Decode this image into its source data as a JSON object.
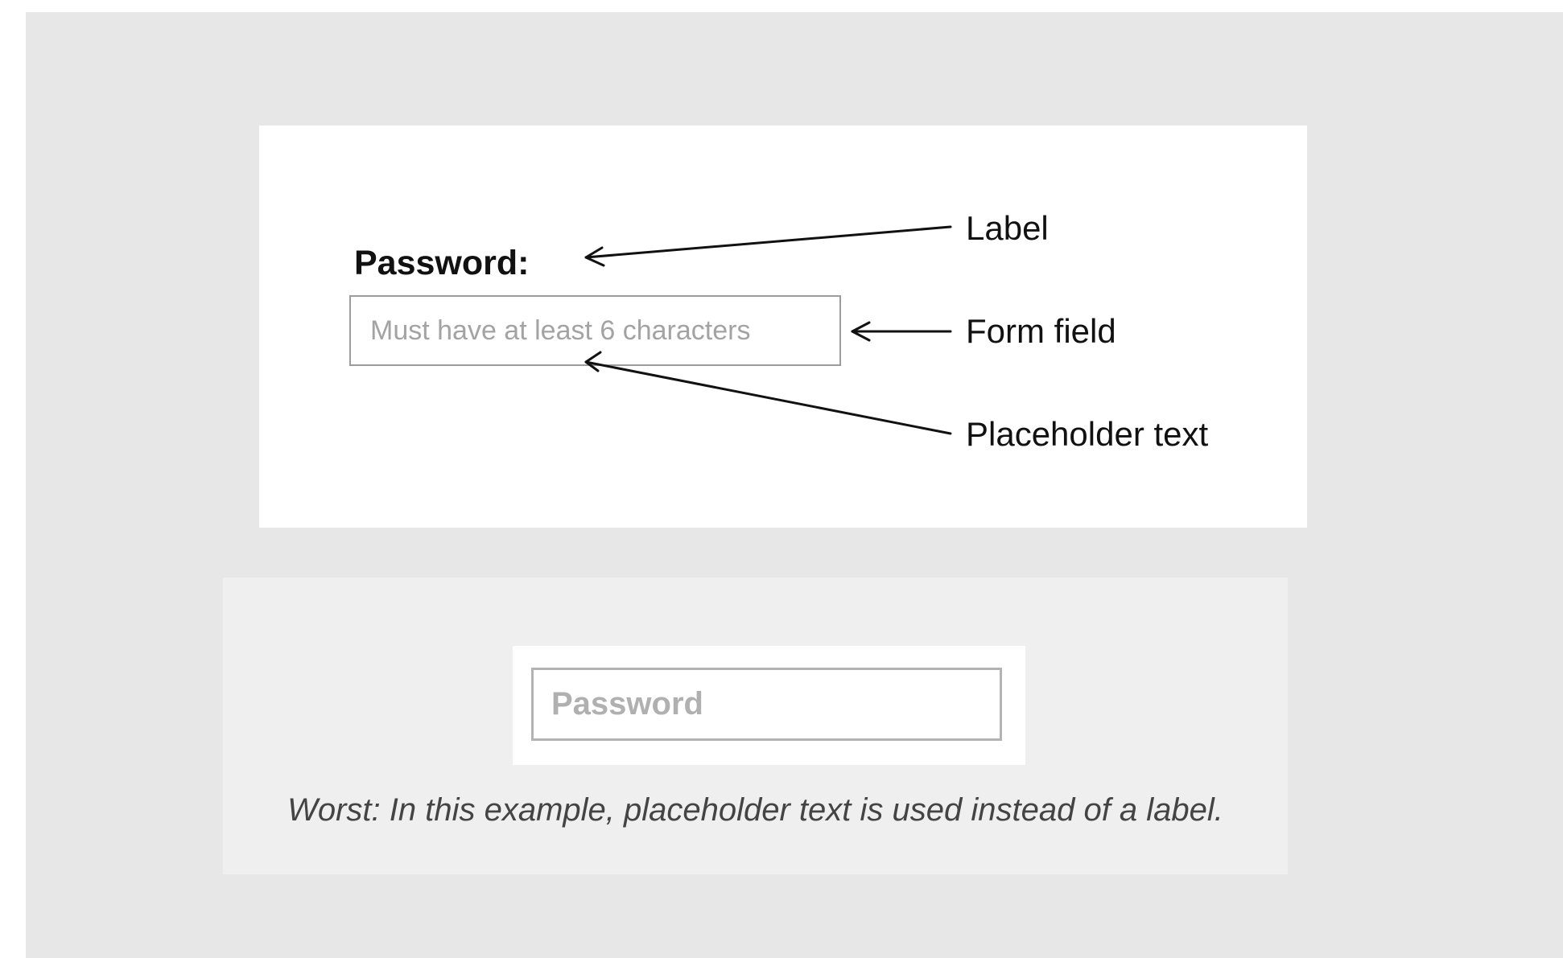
{
  "top_panel": {
    "field_label": "Password:",
    "form_field": {
      "value": "",
      "placeholder": "Must have at least 6 characters"
    },
    "annotations": {
      "label": "Label",
      "form_field": "Form field",
      "placeholder_text": "Placeholder text"
    }
  },
  "bottom_panel": {
    "input": {
      "value": "",
      "placeholder": "Password"
    },
    "caption": "Worst: In this example, placeholder text is used instead of a label."
  },
  "colors": {
    "page_background": "#e7e7e7",
    "panel_background": "#ffffff",
    "example_background": "#efefef",
    "placeholder_text": "#a3a3a3",
    "border": "#9c9c9c"
  }
}
